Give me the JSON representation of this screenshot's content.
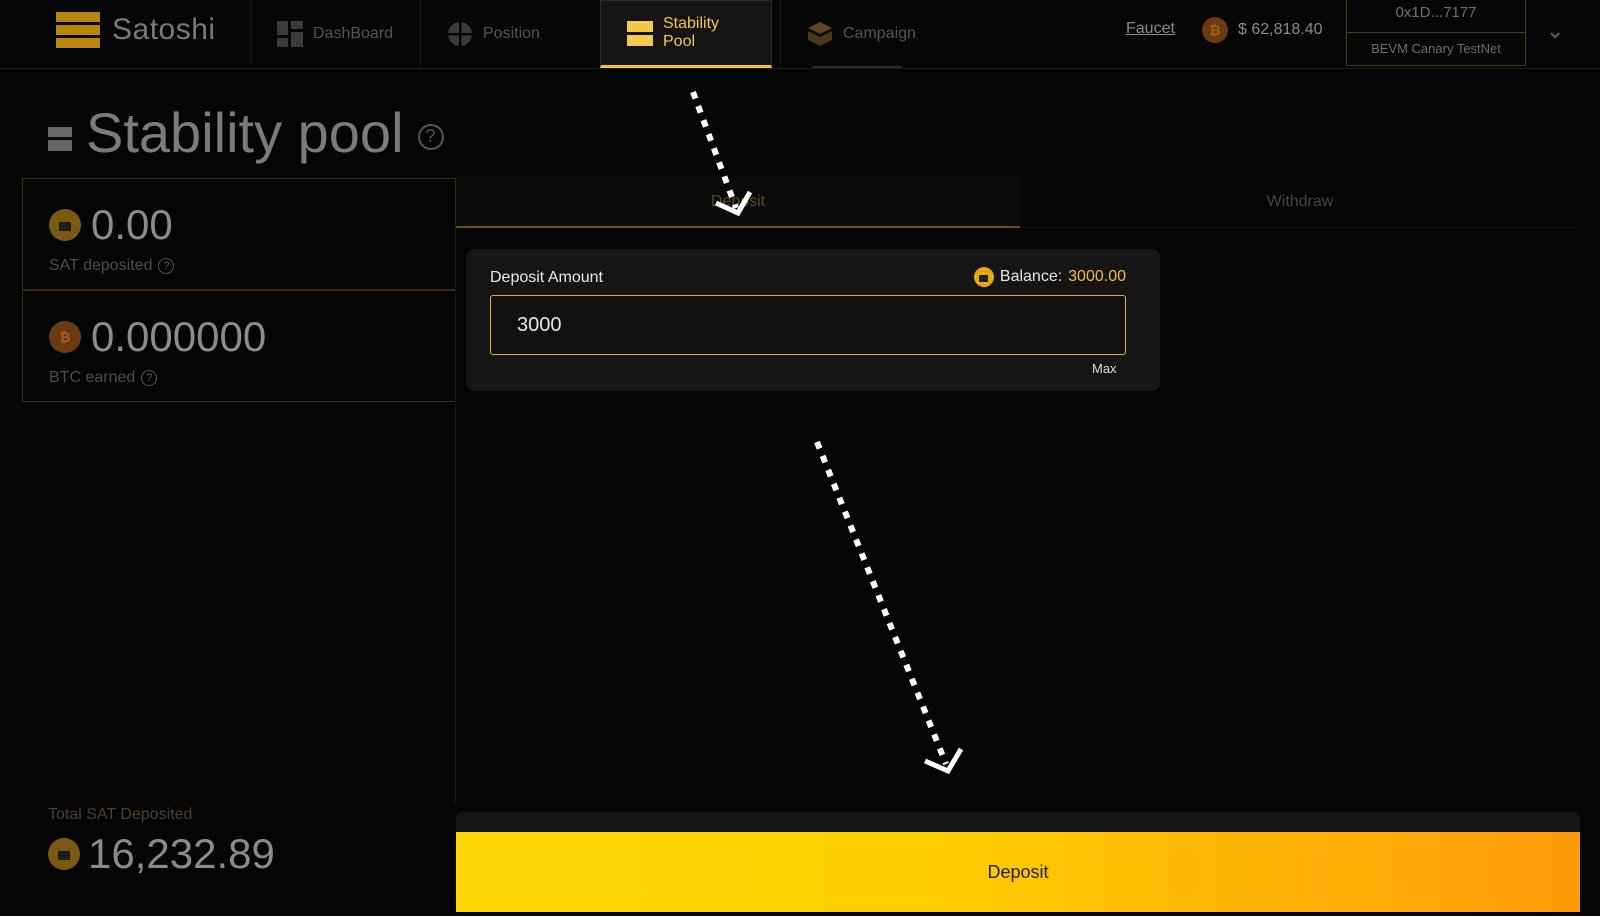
{
  "app": {
    "name": "Satoshi"
  },
  "nav": {
    "items": [
      {
        "label": "DashBoard",
        "icon": "dashboard-icon"
      },
      {
        "label": "Position",
        "icon": "position-icon"
      },
      {
        "label": "Stability Pool",
        "icon": "stability-pool-icon",
        "active": true
      },
      {
        "label": "Campaign",
        "icon": "campaign-icon"
      }
    ],
    "faucet_label": "Faucet",
    "btc_price": "$ 62,818.40",
    "wallet": {
      "address": "0x1D...7177",
      "network": "BEVM Canary TestNet"
    }
  },
  "page": {
    "title": "Stability pool"
  },
  "stats": [
    {
      "value": "0.00",
      "label": "SAT deposited",
      "coin": "sat"
    },
    {
      "value": "0.000000",
      "label": "BTC earned",
      "coin": "btc"
    }
  ],
  "total": {
    "label": "Total SAT Deposited",
    "value": "16,232.89"
  },
  "tabs": {
    "deposit": "Deposit",
    "withdraw": "Withdraw"
  },
  "deposit_form": {
    "label": "Deposit Amount",
    "balance_label": "Balance:",
    "balance_value": "3000.00",
    "input_value": "3000",
    "max_label": "Max",
    "submit_label": "Deposit"
  },
  "colors": {
    "accent": "#f0c23a",
    "button_start": "#ffd808",
    "button_end": "#ff9a0a"
  }
}
